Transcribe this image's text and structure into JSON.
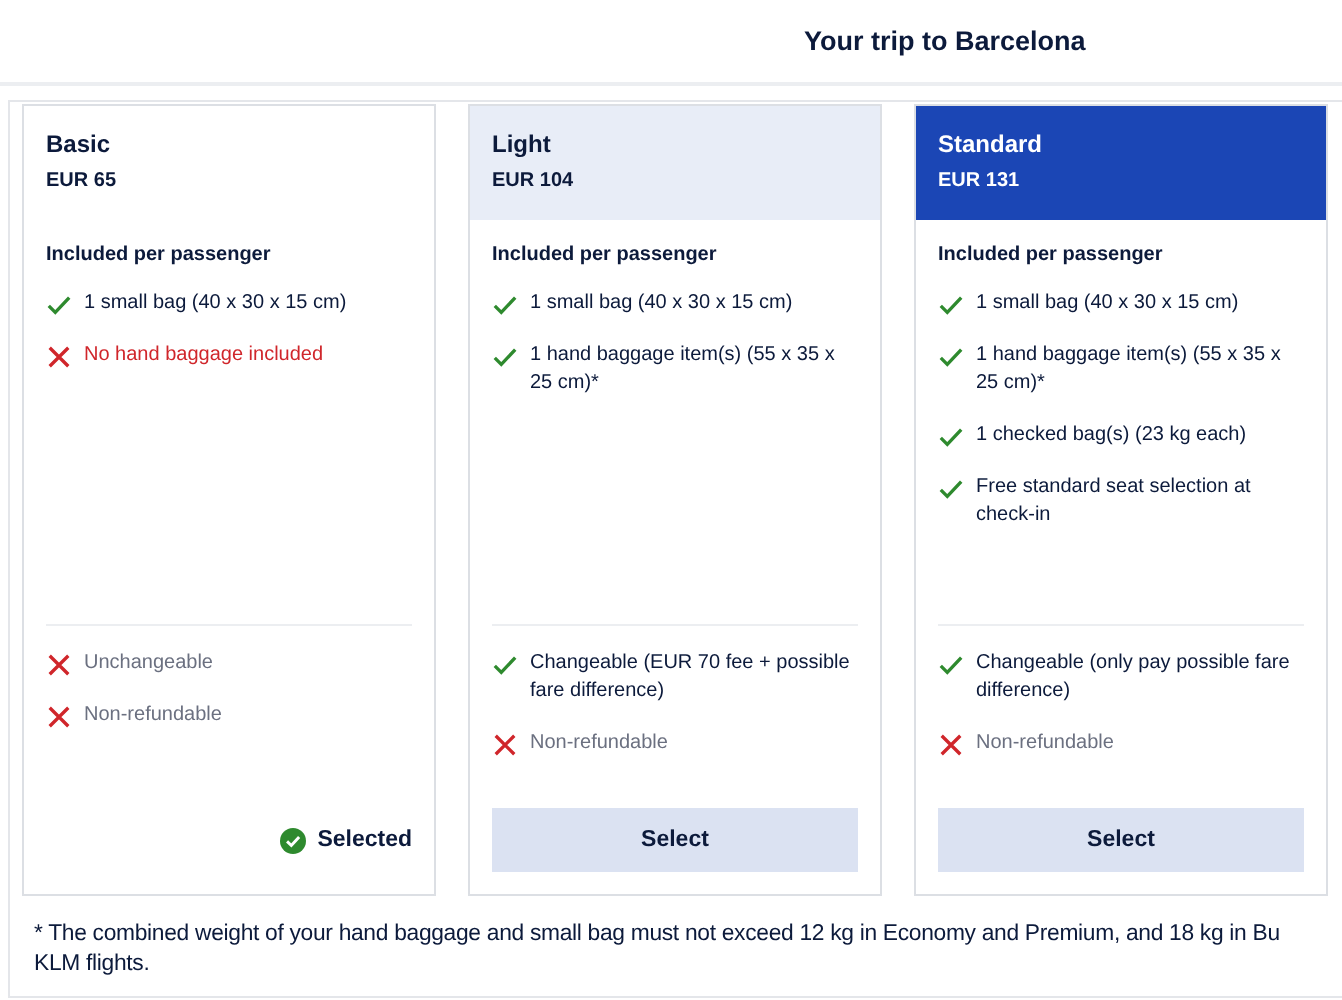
{
  "header": {
    "title": "Your trip to Barcelona"
  },
  "fares": [
    {
      "name": "Basic",
      "price": "EUR 65",
      "kind": "plain",
      "selected": true,
      "section_title": "Included per passenger",
      "included": [
        {
          "kind": "included",
          "text": "1 small bag (40 x 30 x 15 cm)"
        },
        {
          "kind": "missing",
          "text": "No hand baggage included"
        }
      ],
      "conditions": [
        {
          "kind": "not_allowed",
          "text": "Unchangeable"
        },
        {
          "kind": "not_allowed",
          "text": "Non-refundable"
        }
      ],
      "action_label": "Selected"
    },
    {
      "name": "Light",
      "price": "EUR 104",
      "kind": "tint",
      "selected": false,
      "section_title": "Included per passenger",
      "included": [
        {
          "kind": "included",
          "text": "1 small bag (40 x 30 x 15 cm)"
        },
        {
          "kind": "included",
          "text": "1 hand baggage item(s) (55 x 35 x 25 cm)*"
        }
      ],
      "conditions": [
        {
          "kind": "included",
          "text": "Changeable (EUR 70 fee + possible fare difference)"
        },
        {
          "kind": "not_allowed",
          "text": "Non-refundable"
        }
      ],
      "action_label": "Select"
    },
    {
      "name": "Standard",
      "price": "EUR 131",
      "kind": "accent",
      "selected": false,
      "section_title": "Included per passenger",
      "included": [
        {
          "kind": "included",
          "text": "1 small bag (40 x 30 x 15 cm)"
        },
        {
          "kind": "included",
          "text": "1 hand baggage item(s) (55 x 35 x 25 cm)*"
        },
        {
          "kind": "included",
          "text": "1 checked bag(s) (23 kg each)"
        },
        {
          "kind": "included",
          "text": "Free standard seat selection at check-in"
        }
      ],
      "conditions": [
        {
          "kind": "included",
          "text": "Changeable (only pay possible fare difference)"
        },
        {
          "kind": "not_allowed",
          "text": "Non-refundable"
        }
      ],
      "action_label": "Select"
    }
  ],
  "footnote": {
    "lines": [
      "* The combined weight of your hand baggage and small bag must not exceed 12 kg in Economy and Premium, and 18 kg in Bu",
      "KLM flights."
    ]
  }
}
